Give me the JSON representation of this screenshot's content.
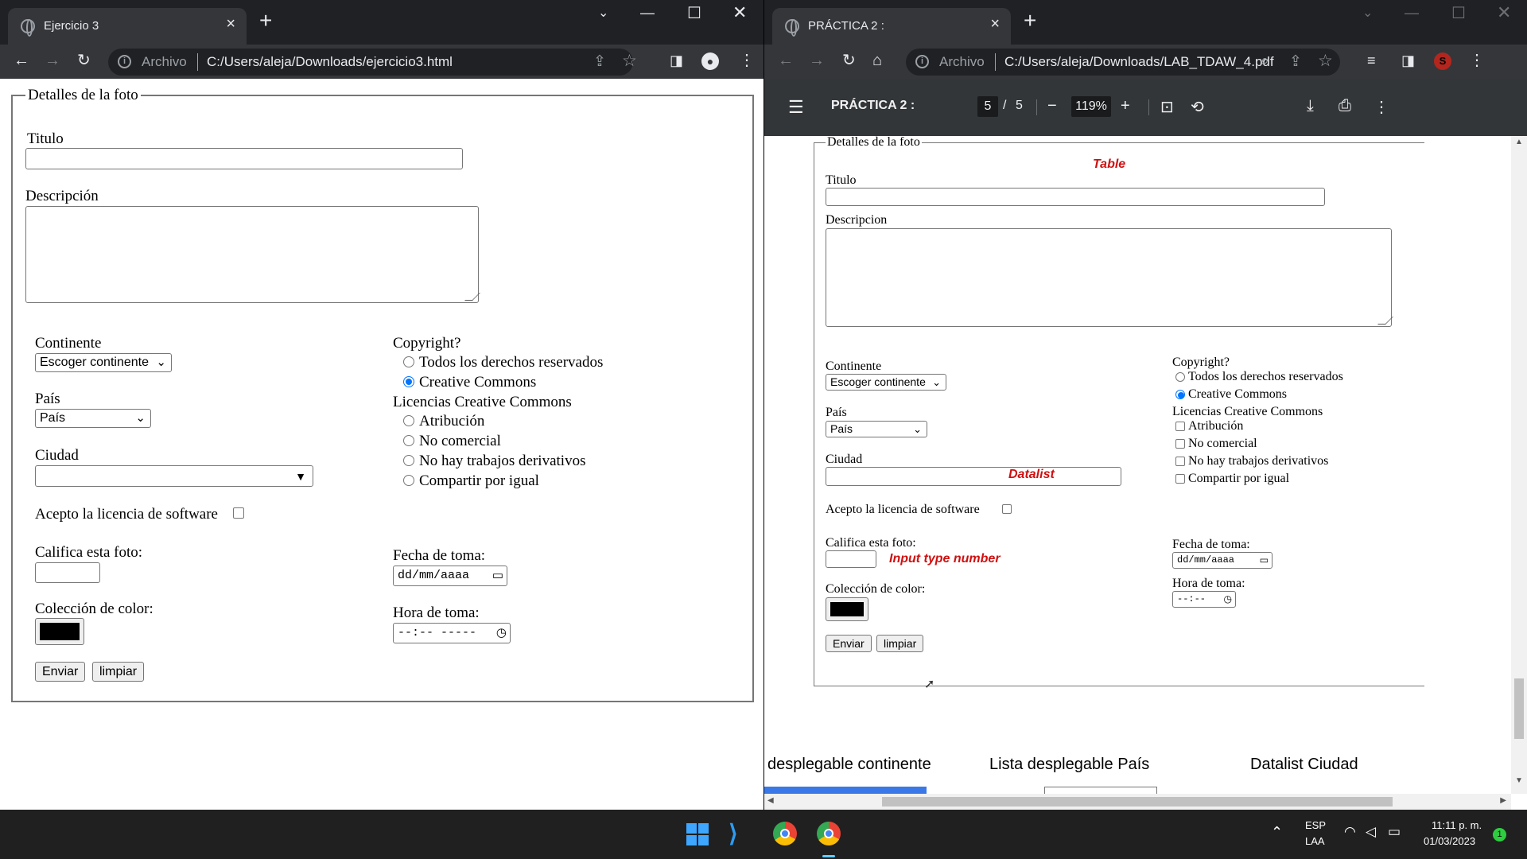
{
  "left": {
    "tab_title": "Ejercicio 3",
    "omnibox_scheme": "Archivo",
    "url": "C:/Users/aleja/Downloads/ejercicio3.html",
    "form": {
      "legend": "Detalles de la foto",
      "titulo_label": "Titulo",
      "descripcion_label": "Descripción",
      "continente_label": "Continente",
      "continente_value": "Escoger continente",
      "pais_label": "País",
      "pais_value": "País",
      "ciudad_label": "Ciudad",
      "acepto_label": "Acepto la licencia de software",
      "califica_label": "Califica esta foto:",
      "coleccion_label": "Colección de color:",
      "enviar": "Enviar",
      "limpiar": "limpiar",
      "copyright_label": "Copyright?",
      "radio_todos": "Todos los derechos reservados",
      "radio_cc": "Creative Commons",
      "licencias_label": "Licencias Creative Commons",
      "lic_atribucion": "Atribución",
      "lic_nocomercial": "No comercial",
      "lic_noderivados": "No hay trabajos derivativos",
      "lic_compartir": "Compartir por igual",
      "fecha_label": "Fecha de toma:",
      "fecha_placeholder": "dd/mm/aaaa",
      "hora_label": "Hora de toma:",
      "hora_placeholder": "--:-- -----"
    }
  },
  "right": {
    "tab_title": "PRÁCTICA 2 :",
    "omnibox_scheme": "Archivo",
    "url": "C:/Users/aleja/Downloads/LAB_TDAW_4.pdf",
    "pdf_title": "PRÁCTICA 2 :",
    "page_current": "5",
    "page_total": "5",
    "page_sep": "/",
    "zoom": "119%",
    "doc": {
      "legend": "Detalles de la foto",
      "note_table": "Table",
      "titulo_label": "Titulo",
      "descripcion_label": "Descripcion",
      "continente_label": "Continente",
      "continente_value": "Escoger continente",
      "pais_label": "País",
      "pais_value": "País",
      "ciudad_label": "Ciudad",
      "note_datalist": "Datalist",
      "acepto_label": "Acepto la licencia de software",
      "califica_label": "Califica esta foto:",
      "note_number": "Input type number",
      "coleccion_label": "Colección de color:",
      "enviar": "Enviar",
      "limpiar": "limpiar",
      "copyright_label": "Copyright?",
      "radio_todos": "Todos los derechos reservados",
      "radio_cc": "Creative Commons",
      "licencias_label": "Licencias Creative Commons",
      "lic_atribucion": "Atribución",
      "lic_nocomercial": "No comercial",
      "lic_noderivados": "No hay trabajos derivativos",
      "lic_compartir": "Compartir por igual",
      "fecha_label": "Fecha de toma:",
      "fecha_placeholder": "dd/mm/aaaa",
      "hora_label": "Hora de toma:",
      "hora_placeholder": "--:--",
      "caption_continente": "desplegable continente",
      "caption_pais": "Lista desplegable País",
      "caption_ciudad": "Datalist Ciudad"
    }
  },
  "taskbar": {
    "lang_top": "ESP",
    "lang_bottom": "LAA",
    "time": "11:11 p. m.",
    "date": "01/03/2023",
    "badge": "1"
  },
  "colors": {
    "accent": "#0075ff",
    "note_red": "#d01010",
    "chrome_dark": "#202124"
  }
}
